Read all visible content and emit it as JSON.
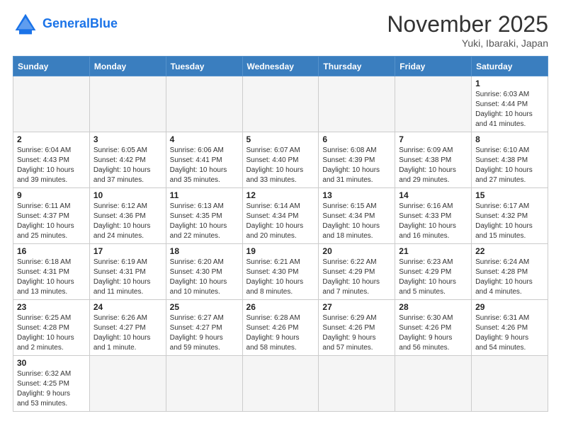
{
  "header": {
    "logo_text_general": "General",
    "logo_text_blue": "Blue",
    "month_title": "November 2025",
    "subtitle": "Yuki, Ibaraki, Japan"
  },
  "weekdays": [
    "Sunday",
    "Monday",
    "Tuesday",
    "Wednesday",
    "Thursday",
    "Friday",
    "Saturday"
  ],
  "weeks": [
    [
      {
        "day": "",
        "info": ""
      },
      {
        "day": "",
        "info": ""
      },
      {
        "day": "",
        "info": ""
      },
      {
        "day": "",
        "info": ""
      },
      {
        "day": "",
        "info": ""
      },
      {
        "day": "",
        "info": ""
      },
      {
        "day": "1",
        "info": "Sunrise: 6:03 AM\nSunset: 4:44 PM\nDaylight: 10 hours\nand 41 minutes."
      }
    ],
    [
      {
        "day": "2",
        "info": "Sunrise: 6:04 AM\nSunset: 4:43 PM\nDaylight: 10 hours\nand 39 minutes."
      },
      {
        "day": "3",
        "info": "Sunrise: 6:05 AM\nSunset: 4:42 PM\nDaylight: 10 hours\nand 37 minutes."
      },
      {
        "day": "4",
        "info": "Sunrise: 6:06 AM\nSunset: 4:41 PM\nDaylight: 10 hours\nand 35 minutes."
      },
      {
        "day": "5",
        "info": "Sunrise: 6:07 AM\nSunset: 4:40 PM\nDaylight: 10 hours\nand 33 minutes."
      },
      {
        "day": "6",
        "info": "Sunrise: 6:08 AM\nSunset: 4:39 PM\nDaylight: 10 hours\nand 31 minutes."
      },
      {
        "day": "7",
        "info": "Sunrise: 6:09 AM\nSunset: 4:38 PM\nDaylight: 10 hours\nand 29 minutes."
      },
      {
        "day": "8",
        "info": "Sunrise: 6:10 AM\nSunset: 4:38 PM\nDaylight: 10 hours\nand 27 minutes."
      }
    ],
    [
      {
        "day": "9",
        "info": "Sunrise: 6:11 AM\nSunset: 4:37 PM\nDaylight: 10 hours\nand 25 minutes."
      },
      {
        "day": "10",
        "info": "Sunrise: 6:12 AM\nSunset: 4:36 PM\nDaylight: 10 hours\nand 24 minutes."
      },
      {
        "day": "11",
        "info": "Sunrise: 6:13 AM\nSunset: 4:35 PM\nDaylight: 10 hours\nand 22 minutes."
      },
      {
        "day": "12",
        "info": "Sunrise: 6:14 AM\nSunset: 4:34 PM\nDaylight: 10 hours\nand 20 minutes."
      },
      {
        "day": "13",
        "info": "Sunrise: 6:15 AM\nSunset: 4:34 PM\nDaylight: 10 hours\nand 18 minutes."
      },
      {
        "day": "14",
        "info": "Sunrise: 6:16 AM\nSunset: 4:33 PM\nDaylight: 10 hours\nand 16 minutes."
      },
      {
        "day": "15",
        "info": "Sunrise: 6:17 AM\nSunset: 4:32 PM\nDaylight: 10 hours\nand 15 minutes."
      }
    ],
    [
      {
        "day": "16",
        "info": "Sunrise: 6:18 AM\nSunset: 4:31 PM\nDaylight: 10 hours\nand 13 minutes."
      },
      {
        "day": "17",
        "info": "Sunrise: 6:19 AM\nSunset: 4:31 PM\nDaylight: 10 hours\nand 11 minutes."
      },
      {
        "day": "18",
        "info": "Sunrise: 6:20 AM\nSunset: 4:30 PM\nDaylight: 10 hours\nand 10 minutes."
      },
      {
        "day": "19",
        "info": "Sunrise: 6:21 AM\nSunset: 4:30 PM\nDaylight: 10 hours\nand 8 minutes."
      },
      {
        "day": "20",
        "info": "Sunrise: 6:22 AM\nSunset: 4:29 PM\nDaylight: 10 hours\nand 7 minutes."
      },
      {
        "day": "21",
        "info": "Sunrise: 6:23 AM\nSunset: 4:29 PM\nDaylight: 10 hours\nand 5 minutes."
      },
      {
        "day": "22",
        "info": "Sunrise: 6:24 AM\nSunset: 4:28 PM\nDaylight: 10 hours\nand 4 minutes."
      }
    ],
    [
      {
        "day": "23",
        "info": "Sunrise: 6:25 AM\nSunset: 4:28 PM\nDaylight: 10 hours\nand 2 minutes."
      },
      {
        "day": "24",
        "info": "Sunrise: 6:26 AM\nSunset: 4:27 PM\nDaylight: 10 hours\nand 1 minute."
      },
      {
        "day": "25",
        "info": "Sunrise: 6:27 AM\nSunset: 4:27 PM\nDaylight: 9 hours\nand 59 minutes."
      },
      {
        "day": "26",
        "info": "Sunrise: 6:28 AM\nSunset: 4:26 PM\nDaylight: 9 hours\nand 58 minutes."
      },
      {
        "day": "27",
        "info": "Sunrise: 6:29 AM\nSunset: 4:26 PM\nDaylight: 9 hours\nand 57 minutes."
      },
      {
        "day": "28",
        "info": "Sunrise: 6:30 AM\nSunset: 4:26 PM\nDaylight: 9 hours\nand 56 minutes."
      },
      {
        "day": "29",
        "info": "Sunrise: 6:31 AM\nSunset: 4:26 PM\nDaylight: 9 hours\nand 54 minutes."
      }
    ],
    [
      {
        "day": "30",
        "info": "Sunrise: 6:32 AM\nSunset: 4:25 PM\nDaylight: 9 hours\nand 53 minutes."
      },
      {
        "day": "",
        "info": ""
      },
      {
        "day": "",
        "info": ""
      },
      {
        "day": "",
        "info": ""
      },
      {
        "day": "",
        "info": ""
      },
      {
        "day": "",
        "info": ""
      },
      {
        "day": "",
        "info": ""
      }
    ]
  ]
}
